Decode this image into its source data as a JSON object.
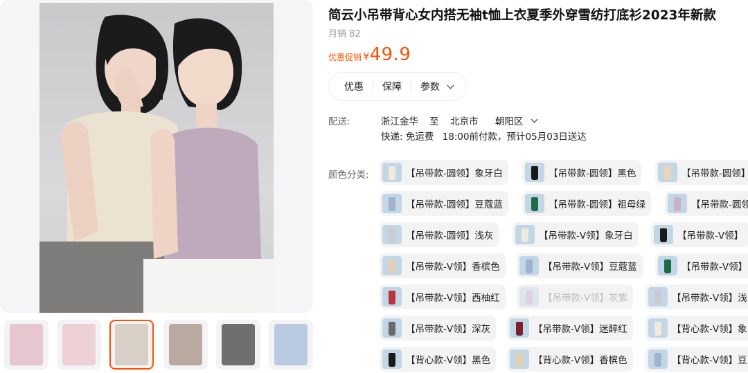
{
  "product": {
    "title": "简云小吊带背心女内搭无袖t恤上衣夏季外穿雪纺打底衫2023年新款",
    "sales": "月销 82",
    "price_label": "优惠促销",
    "price_symbol": "¥",
    "price": "49.9"
  },
  "tabs": [
    {
      "label": "优惠"
    },
    {
      "label": "保障"
    },
    {
      "label": "参数"
    }
  ],
  "shipping": {
    "label": "配送:",
    "from": "浙江金华",
    "to_word": "至",
    "city": "北京市",
    "district": "朝阳区",
    "delivery_method": "快递: 免运费",
    "delivery_time": "18:00前付款，预计05月03日送达"
  },
  "color_label": "颜色分类:",
  "skus": [
    {
      "label": "【吊带款-圆领】象牙白",
      "color": "#efe9de"
    },
    {
      "label": "【吊带款-圆领】黑色",
      "color": "#1a1a1a"
    },
    {
      "label": "【吊带款-圆领】",
      "color": "#e8d6b8"
    },
    {
      "label": "【吊带款-圆领】豆蔻蓝",
      "color": "#9fb3cf"
    },
    {
      "label": "【吊带款-圆领】祖母绿",
      "color": "#1f6b49"
    },
    {
      "label": "【吊带款-圆领",
      "color": "#c9b1c8"
    },
    {
      "label": "【吊带款-圆领】浅灰",
      "color": "#c9cbcf"
    },
    {
      "label": "【吊带款-V领】象牙白",
      "color": "#efe9de"
    },
    {
      "label": "【吊带款-V领】",
      "color": "#1a1a1a"
    },
    {
      "label": "【吊带款-V领】香槟色",
      "color": "#e3cfb1"
    },
    {
      "label": "【吊带款-V领】豆蔻蓝",
      "color": "#9fb3cf"
    },
    {
      "label": "【吊带款-V领】",
      "color": "#1f6b49"
    },
    {
      "label": "【吊带款-V领】西柚红",
      "color": "#b8333b"
    },
    {
      "label": "【吊带款-V领】灰紫",
      "color": "#c9b7cf",
      "disabled": true
    },
    {
      "label": "【吊带款-V领】浅",
      "color": "#c9cbcf"
    },
    {
      "label": "【吊带款-V领】深灰",
      "color": "#6b6b6e"
    },
    {
      "label": "【吊带款-V领】迷醉红",
      "color": "#7a1f2e"
    },
    {
      "label": "【背心款-V领】象",
      "color": "#efe9de"
    },
    {
      "label": "【背心款-V领】黑色",
      "color": "#1a1a1a"
    },
    {
      "label": "【背心款-V领】香槟色",
      "color": "#e3cfb1"
    },
    {
      "label": "【背心款-V领】豆",
      "color": "#9fb3cf"
    }
  ],
  "thumbnails": [
    {
      "color": "#e7c7cf"
    },
    {
      "color": "#ecd0d6"
    },
    {
      "color": "#d8cfc6",
      "active": true
    },
    {
      "color": "#b9a9a0"
    },
    {
      "color": "#6f6e70"
    },
    {
      "color": "#b9cbe0"
    }
  ]
}
